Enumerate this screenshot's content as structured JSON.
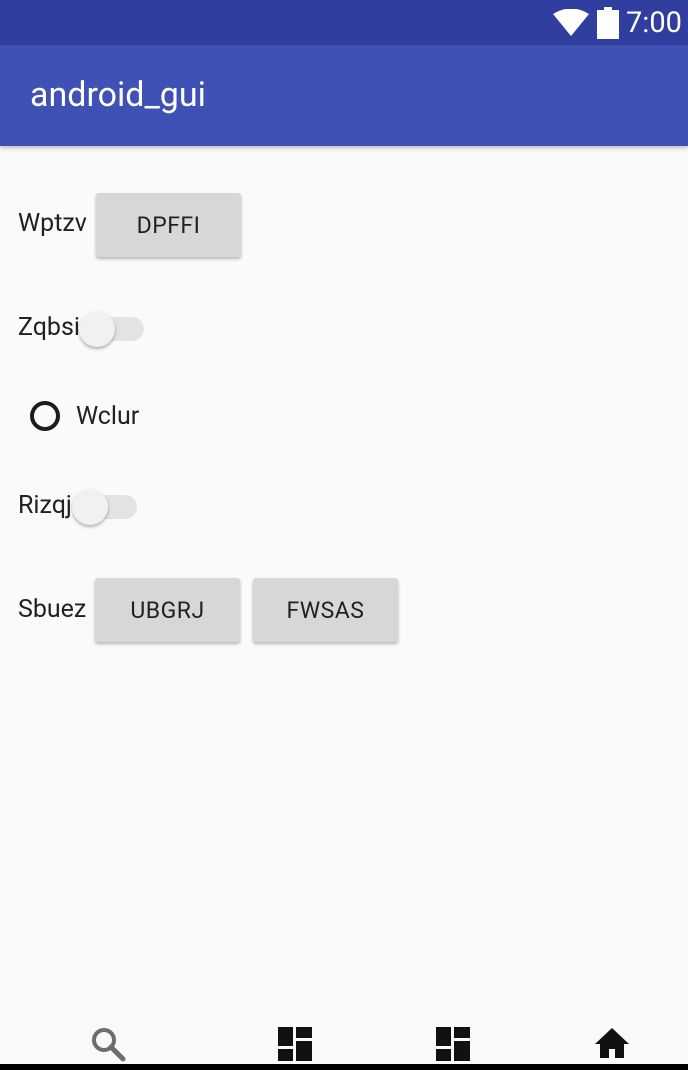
{
  "status_bar": {
    "time": "7:00"
  },
  "app_bar": {
    "title": "android_gui"
  },
  "rows": {
    "row1": {
      "label": "Wptzv",
      "button": "DPFFI"
    },
    "row2": {
      "label": "Zqbsi",
      "switch_on": false
    },
    "row3": {
      "radio_label": "Wclur",
      "radio_checked": false
    },
    "row4": {
      "label": "Rizqj",
      "switch_on": false
    },
    "row5": {
      "label": "Sbuez",
      "button1": "UBGRJ",
      "button2": "FWSAS"
    }
  },
  "bottom_nav": {
    "items": [
      {
        "icon": "search-icon"
      },
      {
        "icon": "dashboard-icon"
      },
      {
        "icon": "dashboard-icon"
      },
      {
        "icon": "home-icon"
      }
    ]
  },
  "colors": {
    "status_bar": "#303f9f",
    "app_bar": "#3f51b5",
    "background": "#fafafa",
    "button": "#d6d7d7"
  }
}
